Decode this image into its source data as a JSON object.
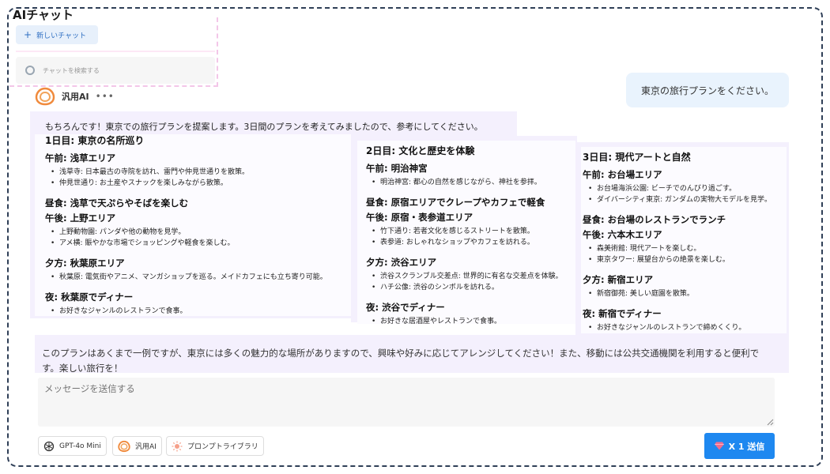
{
  "app": {
    "title": "AIチャット"
  },
  "sidebar": {
    "new_chat_label": "新しいチャット",
    "search_placeholder": "チャットを検索する"
  },
  "user_message": "東京の旅行プランをください。",
  "assistant": {
    "name": "汎用AI",
    "more": "•••",
    "intro": "もちろんです！東京での旅行プランを提案します。3日間のプランを考えてみましたので、参考にしてください。",
    "days": [
      {
        "title": "1日目: 東京の名所巡り",
        "sections": [
          {
            "heading": "午前: 浅草エリア",
            "items": [
              "浅草寺: 日本最古の寺院を訪れ、雷門や仲見世通りを散策。",
              "仲見世通り: お土産やスナックを楽しみながら散策。"
            ]
          },
          {
            "heading": "昼食: 浅草で天ぷらやそばを楽しむ",
            "items": []
          },
          {
            "heading": "午後: 上野エリア",
            "items": [
              "上野動物園: パンダや他の動物を見学。",
              "アメ横: 賑やかな市場でショッピングや軽食を楽しむ。"
            ]
          },
          {
            "heading": "夕方: 秋葉原エリア",
            "items": [
              "秋葉原: 電気街やアニメ、マンガショップを巡る。メイドカフェにも立ち寄り可能。"
            ]
          },
          {
            "heading": "夜: 秋葉原でディナー",
            "items": [
              "お好きなジャンルのレストランで食事。"
            ]
          }
        ]
      },
      {
        "title": "2日目: 文化と歴史を体験",
        "sections": [
          {
            "heading": "午前: 明治神宮",
            "items": [
              "明治神宮: 都心の自然を感じながら、神社を参拝。"
            ]
          },
          {
            "heading": "昼食: 原宿エリアでクレープやカフェで軽食",
            "items": []
          },
          {
            "heading": "午後: 原宿・表参道エリア",
            "items": [
              "竹下通り: 若者文化を感じるストリートを散策。",
              "表参道: おしゃれなショップやカフェを訪れる。"
            ]
          },
          {
            "heading": "夕方: 渋谷エリア",
            "items": [
              "渋谷スクランブル交差点: 世界的に有名な交差点を体験。",
              "ハチ公像: 渋谷のシンボルを訪れる。"
            ]
          },
          {
            "heading": "夜: 渋谷でディナー",
            "items": [
              "お好きな居酒屋やレストランで食事。"
            ]
          }
        ]
      },
      {
        "title": "3日目: 現代アートと自然",
        "sections": [
          {
            "heading": "午前: お台場エリア",
            "items": [
              "お台場海浜公園: ビーチでのんびり過ごす。",
              "ダイバーシティ東京: ガンダムの実物大モデルを見学。"
            ]
          },
          {
            "heading": "昼食: お台場のレストランでランチ",
            "items": []
          },
          {
            "heading": "午後: 六本木エリア",
            "items": [
              "森美術館: 現代アートを楽しむ。",
              "東京タワー: 展望台からの絶景を楽しむ。"
            ]
          },
          {
            "heading": "夕方: 新宿エリア",
            "items": [
              "新宿御苑: 美しい庭園を散策。"
            ]
          },
          {
            "heading": "夜: 新宿でディナー",
            "items": [
              "お好きなジャンルのレストランで締めくくり。"
            ]
          }
        ]
      }
    ],
    "outro": "このプランはあくまで一例ですが、東京には多くの魅力的な場所がありますので、興味や好みに応じてアレンジしてください！また、移動には公共交通機関を利用すると便利です。楽しい旅行を！"
  },
  "composer": {
    "placeholder": "メッセージを送信する",
    "model_chips": [
      "GPT-4o Mini",
      "汎用AI",
      "プロンプトライブラリ"
    ],
    "send_label": "X 1 送信"
  },
  "colors": {
    "accent": "#1e88f0",
    "card": "#f4f0fd",
    "user_bubble": "#e9f3fd"
  }
}
